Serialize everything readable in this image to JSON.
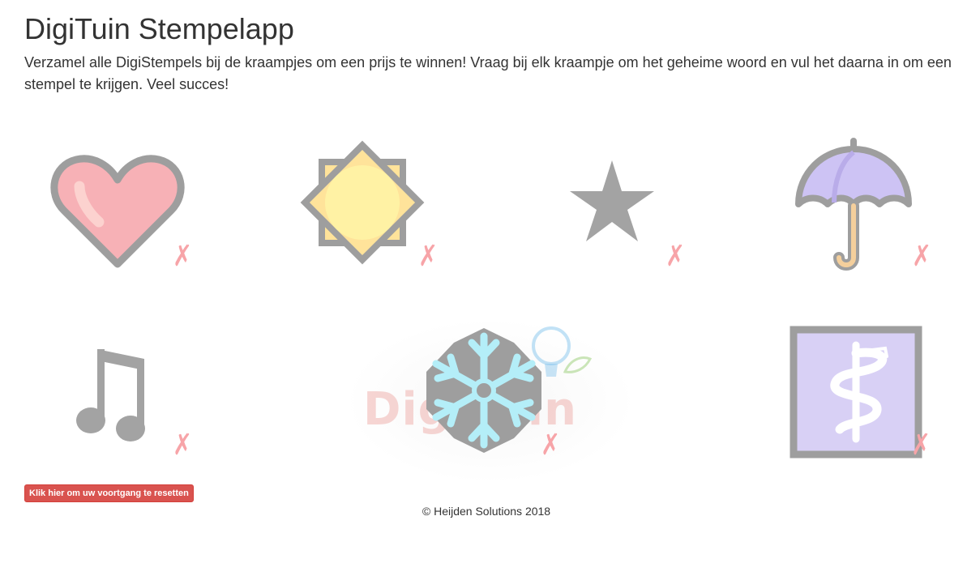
{
  "page": {
    "title": "DigiTuin Stempelapp",
    "intro": "Verzamel alle DigiStempels bij de kraampjes om een prijs te winnen! Vraag bij elk kraampje om het geheime woord en vul het daarna in om een stempel te krijgen. Veel succes!"
  },
  "stamps": [
    {
      "icon": "heart-icon",
      "status_mark": "✗",
      "collected": false
    },
    {
      "icon": "sun-icon",
      "status_mark": "✗",
      "collected": false
    },
    {
      "icon": "star-icon",
      "status_mark": "✗",
      "collected": false
    },
    {
      "icon": "umbrella-icon",
      "status_mark": "✗",
      "collected": false
    },
    {
      "icon": "music-note-icon",
      "status_mark": "✗",
      "collected": false
    },
    {
      "icon": "snowflake-icon",
      "status_mark": "✗",
      "collected": false
    },
    {
      "icon": "caduceus-icon",
      "status_mark": "✗",
      "collected": false
    }
  ],
  "watermark": {
    "text": "DigiTuin"
  },
  "reset_button": {
    "label": "Klik hier om uw voortgang te resetten"
  },
  "footer": {
    "text": "© Heijden Solutions 2018"
  },
  "colors": {
    "not_collected_mark": "#f7a4a8",
    "reset_button": "#d9534f",
    "icon_outline": "#9e9e9e"
  }
}
